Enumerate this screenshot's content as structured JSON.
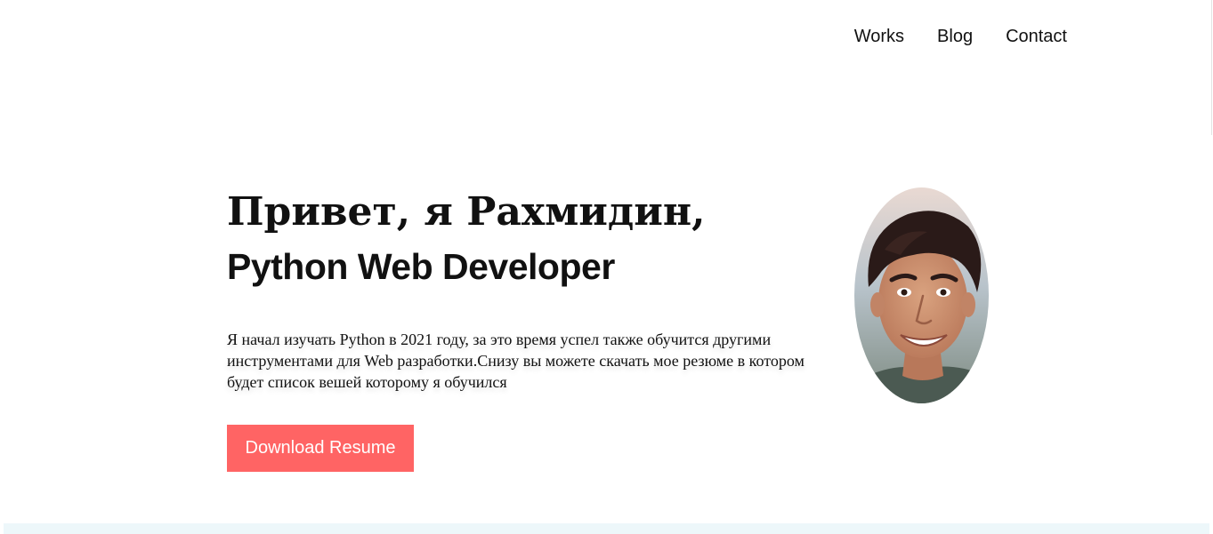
{
  "nav": {
    "items": [
      {
        "label": "Works"
      },
      {
        "label": "Blog"
      },
      {
        "label": "Contact"
      }
    ]
  },
  "hero": {
    "greeting": "Привет, я Рахмидин,",
    "role": "Python Web Developer",
    "description": "Я начал изучать Python в 2021 году, за это время успел также обучится другими инструментами для Web разработки.Снизу вы можете скачать мое резюме в котором будет список вешей которому я обучился",
    "button_label": "Download Resume"
  },
  "colors": {
    "accent": "#ff6464",
    "text": "#111111",
    "band": "#edf7fa"
  }
}
